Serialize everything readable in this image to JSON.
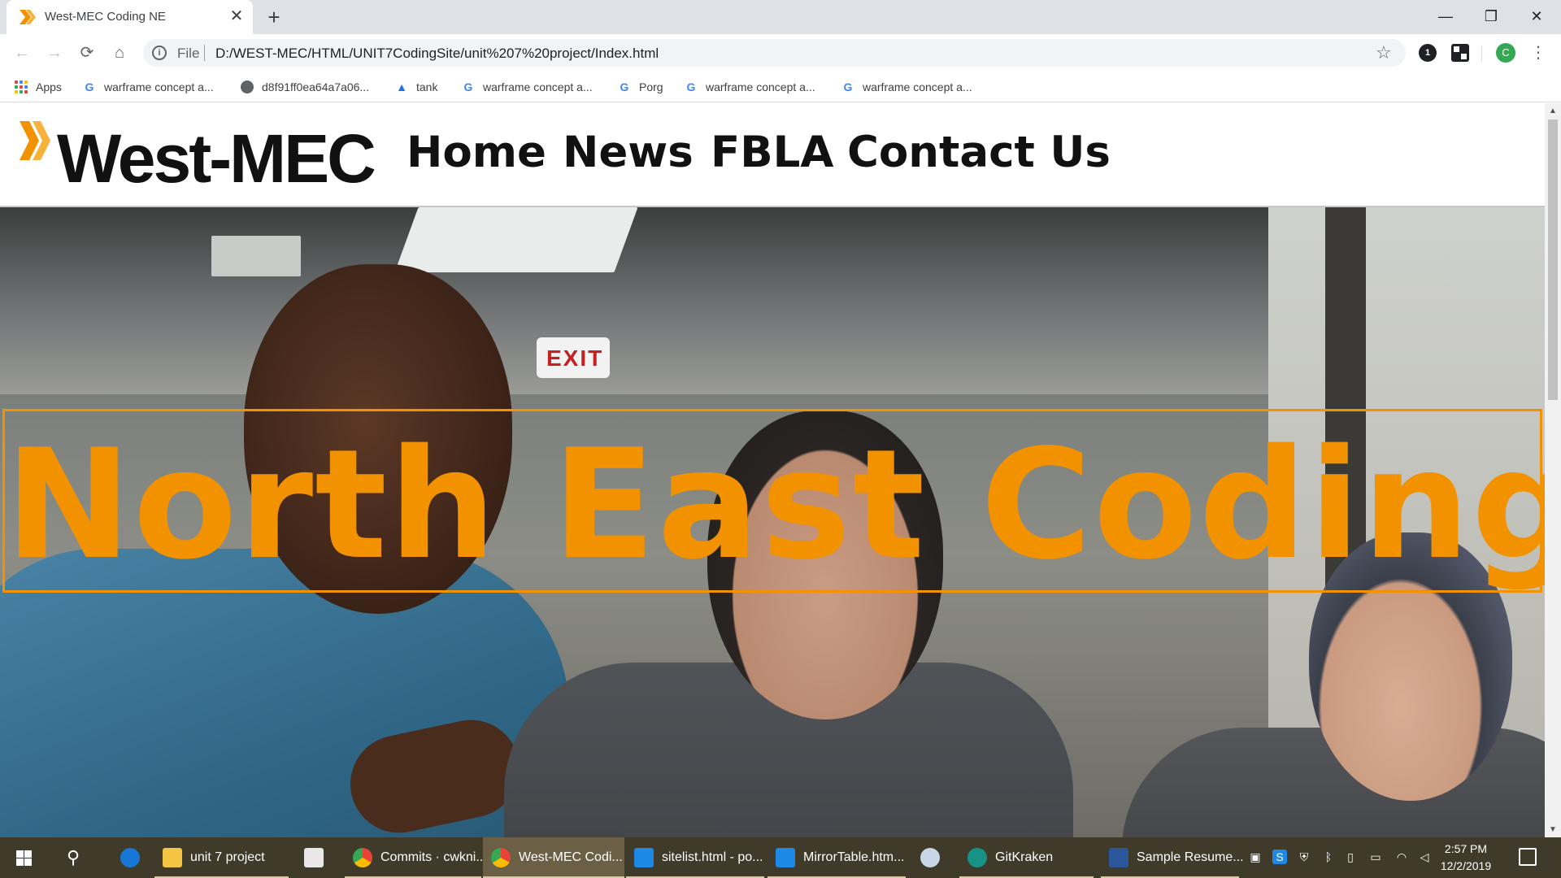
{
  "browser": {
    "tab_title": "West-MEC Coding NE",
    "tab_close_glyph": "✕",
    "new_tab_glyph": "+",
    "window_controls": {
      "minimize": "—",
      "restore": "❐",
      "close": "✕"
    },
    "nav": {
      "back": "←",
      "forward": "→",
      "reload": "⟳",
      "home": "⌂"
    },
    "address": {
      "scheme_label": "File",
      "url": "D:/WEST-MEC/HTML/UNIT7CodingSite/unit%207%20project/Index.html"
    },
    "star_glyph": "☆",
    "extension_badge": "1",
    "profile_initial": "C",
    "menu_glyph": "⋮",
    "bookmarks": [
      {
        "label": "Apps",
        "icon": "apps-grid-icon"
      },
      {
        "label": "warframe concept a...",
        "icon": "google-icon"
      },
      {
        "label": "d8f91ff0ea64a7a06...",
        "icon": "globe-icon"
      },
      {
        "label": "tank",
        "icon": "drive-icon"
      },
      {
        "label": "warframe concept a...",
        "icon": "google-icon"
      },
      {
        "label": "Porg",
        "icon": "google-icon"
      },
      {
        "label": "warframe concept a...",
        "icon": "google-icon"
      },
      {
        "label": "warframe concept a...",
        "icon": "google-icon"
      }
    ]
  },
  "site": {
    "logo_text": "West-MEC",
    "nav_links": [
      "Home",
      "News",
      "FBLA",
      "Contact Us"
    ],
    "hero_title": "North East Coding",
    "exit_sign": "EXIT",
    "accent_color": "#f39200"
  },
  "taskbar": {
    "search_glyph": "⚲",
    "items": [
      {
        "label": "unit 7 project",
        "icon": "folder-icon",
        "active": false
      },
      {
        "label": "Commits · cwkni...",
        "icon": "chrome-icon",
        "active": false
      },
      {
        "label": "West-MEC Codi...",
        "icon": "chrome-icon",
        "active": true
      },
      {
        "label": "sitelist.html - po...",
        "icon": "vscode-icon",
        "active": false
      },
      {
        "label": "MirrorTable.htm...",
        "icon": "vscode-icon",
        "active": false
      },
      {
        "label": "GitKraken",
        "icon": "gitkraken-icon",
        "active": false
      },
      {
        "label": "Sample Resume...",
        "icon": "word-icon",
        "active": false
      }
    ],
    "clock_time": "2:57 PM",
    "clock_date": "12/2/2019"
  }
}
